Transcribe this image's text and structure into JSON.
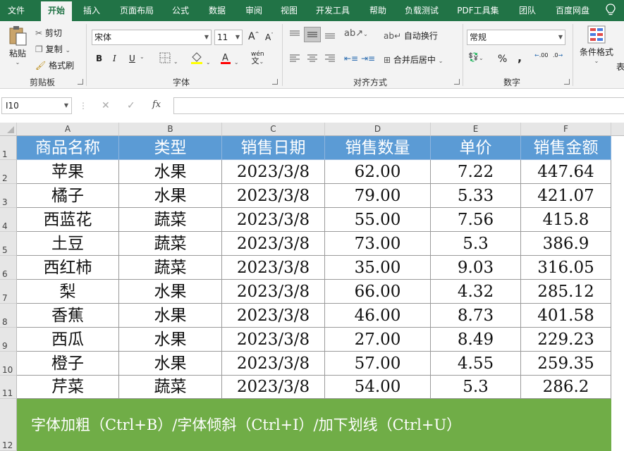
{
  "tabs": [
    "文件",
    "开始",
    "插入",
    "页面布局",
    "公式",
    "数据",
    "审阅",
    "视图",
    "开发工具",
    "帮助",
    "负载测试",
    "PDF工具集",
    "团队",
    "百度网盘"
  ],
  "ribbon": {
    "clipboard": {
      "paste": "粘贴",
      "cut": "剪切",
      "copy": "复制",
      "format_painter": "格式刷",
      "label": "剪贴板"
    },
    "font": {
      "font_name": "宋体",
      "font_size": "11",
      "bold": "B",
      "italic": "I",
      "underline": "U",
      "label": "字体",
      "grow": "A",
      "shrink": "A",
      "wen": "wén"
    },
    "align": {
      "wrap": "自动换行",
      "merge": "合并后居中",
      "label": "对齐方式"
    },
    "number": {
      "format": "常规",
      "percent": "%",
      "comma": ",",
      "label": "数字",
      "inc": ".00",
      "dec": ".0"
    },
    "styles": {
      "conditional": "条件格式",
      "more": "表"
    }
  },
  "formula_bar": {
    "name_box": "I10",
    "fx": "fx",
    "cancel": "✕",
    "enter": "✓",
    "formula": ""
  },
  "columns": [
    "A",
    "B",
    "C",
    "D",
    "E",
    "F"
  ],
  "rows": [
    "1",
    "2",
    "3",
    "4",
    "5",
    "6",
    "7",
    "8",
    "9",
    "10",
    "11",
    "12"
  ],
  "table": {
    "headers": [
      "商品名称",
      "类型",
      "销售日期",
      "销售数量",
      "单价",
      "销售金额"
    ],
    "data": [
      [
        "苹果",
        "水果",
        "2023/3/8",
        "62.00",
        "7.22",
        "447.64"
      ],
      [
        "橘子",
        "水果",
        "2023/3/8",
        "79.00",
        "5.33",
        "421.07"
      ],
      [
        "西蓝花",
        "蔬菜",
        "2023/3/8",
        "55.00",
        "7.56",
        "415.8"
      ],
      [
        "土豆",
        "蔬菜",
        "2023/3/8",
        "73.00",
        "5.3",
        "386.9"
      ],
      [
        "西红柿",
        "蔬菜",
        "2023/3/8",
        "35.00",
        "9.03",
        "316.05"
      ],
      [
        "梨",
        "水果",
        "2023/3/8",
        "66.00",
        "4.32",
        "285.12"
      ],
      [
        "香蕉",
        "水果",
        "2023/3/8",
        "46.00",
        "8.73",
        "401.58"
      ],
      [
        "西瓜",
        "水果",
        "2023/3/8",
        "27.00",
        "8.49",
        "229.23"
      ],
      [
        "橙子",
        "水果",
        "2023/3/8",
        "57.00",
        "4.55",
        "259.35"
      ],
      [
        "芹菜",
        "蔬菜",
        "2023/3/8",
        "54.00",
        "5.3",
        "286.2"
      ]
    ]
  },
  "banner": "字体加粗（Ctrl+B）/字体倾斜（Ctrl+I）/加下划线（Ctrl+U）",
  "colors": {
    "tab_bar": "#217346",
    "header_fill": "#5b9bd5",
    "banner_fill": "#70ad47"
  }
}
